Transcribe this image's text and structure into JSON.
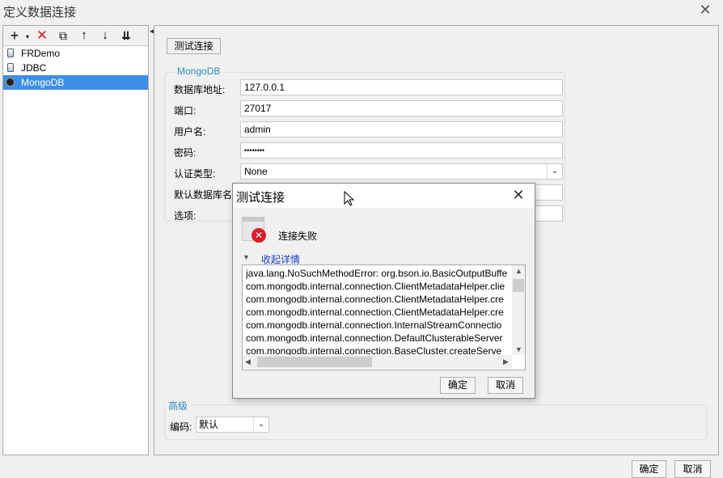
{
  "window": {
    "title": "定义数据连接"
  },
  "tree": {
    "items": [
      {
        "label": "FRDemo",
        "selected": false
      },
      {
        "label": "JDBC",
        "selected": false
      },
      {
        "label": "MongoDB",
        "selected": true
      }
    ],
    "toolbar": [
      "add-icon",
      "delete-icon",
      "copy-icon",
      "move-up-icon",
      "move-down-icon",
      "sort-icon"
    ]
  },
  "form": {
    "test_button": "测试连接",
    "group_title": "MongoDB",
    "fields": {
      "host": {
        "label": "数据库地址:",
        "value": "127.0.0.1"
      },
      "port": {
        "label": "端口:",
        "value": "27017"
      },
      "user": {
        "label": "用户名:",
        "value": "admin"
      },
      "password": {
        "label": "密码:",
        "value": "••••••••"
      },
      "auth_type": {
        "label": "认证类型:",
        "value": "None"
      },
      "default_db": {
        "label": "默认数据库名",
        "value": ""
      },
      "options": {
        "label": "选项:",
        "value": ""
      }
    },
    "advanced": {
      "title": "高级",
      "encoding_label": "编码:",
      "encoding_value": "默认"
    }
  },
  "footer": {
    "ok": "确定",
    "cancel": "取消"
  },
  "dialog": {
    "title": "测试连接",
    "message": "连接失败",
    "toggle": "收起详情",
    "trace": [
      "java.lang.NoSuchMethodError: org.bson.io.BasicOutputBuffe",
      "com.mongodb.internal.connection.ClientMetadataHelper.clie",
      "com.mongodb.internal.connection.ClientMetadataHelper.cre",
      "com.mongodb.internal.connection.ClientMetadataHelper.cre",
      "com.mongodb.internal.connection.InternalStreamConnectio",
      "com.mongodb.internal.connection.DefaultClusterableServer",
      "com.mongodb.internal.connection.BaseCluster.createServe"
    ],
    "ok": "确定",
    "cancel": "取消"
  },
  "colors": {
    "selection": "#3d8ee6",
    "group_title": "#2c8cc4",
    "error": "#d81e2a",
    "link": "#1a3ccc"
  }
}
